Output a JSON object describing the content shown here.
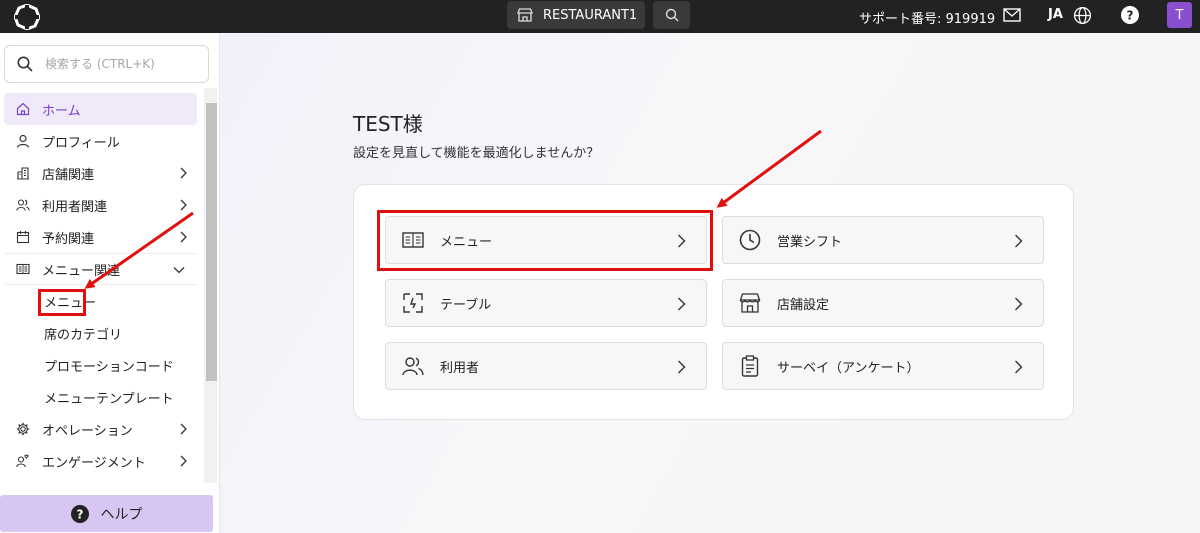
{
  "topbar": {
    "store_name": "RESTAURANT1",
    "support_label": "サポート番号: 919919",
    "language": "JA",
    "avatar_letter": "T"
  },
  "sidebar": {
    "search_placeholder": "検索する (CTRL+K)",
    "items": [
      {
        "label": "ホーム",
        "icon": "home-icon",
        "active": true
      },
      {
        "label": "プロフィール",
        "icon": "person-icon"
      },
      {
        "label": "店舗関連",
        "icon": "building-icon"
      },
      {
        "label": "利用者関連",
        "icon": "users-icon"
      },
      {
        "label": "予約関連",
        "icon": "calendar-icon"
      },
      {
        "label": "メニュー関連",
        "icon": "book-icon",
        "expanded": true
      }
    ],
    "subitems": [
      "メニュー",
      "席のカテゴリ",
      "プロモーションコード",
      "メニューテンプレート"
    ],
    "items_after": [
      {
        "label": "オペレーション",
        "icon": "gear-icon"
      },
      {
        "label": "エンゲージメント",
        "icon": "engagement-icon"
      }
    ],
    "help_label": "ヘルプ"
  },
  "main": {
    "greeting": "TEST様",
    "subtitle": "設定を見直して機能を最適化しませんか？",
    "tiles": [
      {
        "label": "メニュー",
        "icon": "book-icon"
      },
      {
        "label": "営業シフト",
        "icon": "clock-icon"
      },
      {
        "label": "テーブル",
        "icon": "table-icon"
      },
      {
        "label": "店舗設定",
        "icon": "storefront-icon"
      },
      {
        "label": "利用者",
        "icon": "users-icon"
      },
      {
        "label": "サーベイ（アンケート）",
        "icon": "clipboard-icon"
      }
    ]
  },
  "colors": {
    "accent": "#7b3fc8",
    "topbar_bg": "#222222",
    "annotation": "#e01010",
    "help_bg": "#d8c6f2"
  }
}
